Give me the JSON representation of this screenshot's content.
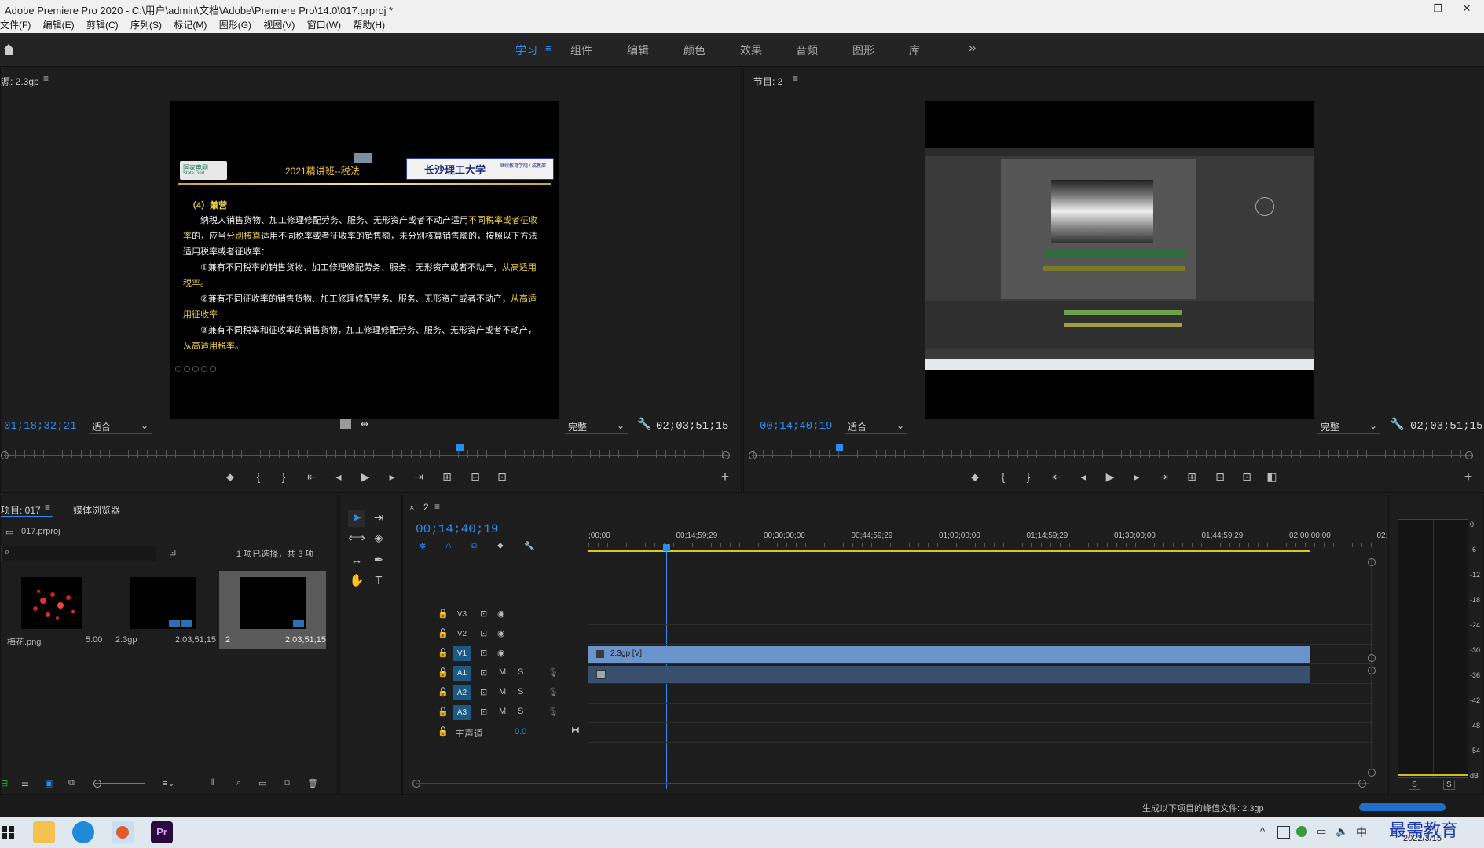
{
  "window": {
    "title": "Adobe Premiere Pro 2020 - C:\\用户\\admin\\文档\\Adobe\\Premiere Pro\\14.0\\017.prproj *",
    "minimize": "—",
    "maximize": "❐",
    "close": "✕"
  },
  "menu": [
    "文件(F)",
    "编辑(E)",
    "剪辑(C)",
    "序列(S)",
    "标记(M)",
    "图形(G)",
    "视图(V)",
    "窗口(W)",
    "帮助(H)"
  ],
  "workspaces": {
    "tabs": [
      "学习",
      "组件",
      "编辑",
      "颜色",
      "效果",
      "音频",
      "图形",
      "库"
    ],
    "active": "学习",
    "more": "»"
  },
  "source_monitor": {
    "title": "源: 2.3gp",
    "timecode": "01;18;32;21",
    "zoom": "适合",
    "quality": "完整",
    "duration": "02;03;51;15",
    "playhead_fraction": 0.63,
    "slide": {
      "logo_left": "国家电网",
      "logo_left_sub": "State Grid",
      "header": "2021精讲班--税法",
      "logo_right": "长沙理工大学",
      "logo_right_sub": "继续教育学院 / 成教部",
      "section": "（4）兼营",
      "p1a": "纳税人销售货物、加工修理修配劳务、服务、无形资产或者不动产适用",
      "p1b": "不同税率或者征收率",
      "p1c": "的，应当",
      "p1d": "分别核算",
      "p1e": "适用不同税率或者征收率的销售额，未分别核算销售额的，按照以下方法适用税率或者征收率：",
      "i1": "①兼有不同税率的销售货物、加工修理修配劳务、服务、无形资产或者不动产，",
      "i1h": "从高适用税率。",
      "i2": "②兼有不同征收率的销售货物、加工修理修配劳务、服务、无形资产或者不动产，",
      "i2h": "从高适用征收率",
      "i3": "③兼有不同税率和征收率的销售货物，加工修理修配劳务、服务、无形资产或者不动产，",
      "i3h": "从高适用税率。"
    }
  },
  "program_monitor": {
    "title": "节目: 2",
    "timecode": "00;14;40;19",
    "zoom": "适合",
    "quality": "完整",
    "duration": "02;03;51;15",
    "playhead_fraction": 0.12
  },
  "project": {
    "tab_project": "项目: 017",
    "tab_media": "媒体浏览器",
    "file": "017.prproj",
    "selection_info": "1 项已选择，共 3 项",
    "items": [
      {
        "name": "梅花.png",
        "duration": "5:00"
      },
      {
        "name": "2.3gp",
        "duration": "2;03;51;15"
      },
      {
        "name": "2",
        "duration": "2;03;51;15"
      }
    ]
  },
  "timeline": {
    "tab": "2",
    "close": "×",
    "timecode": "00;14;40;19",
    "ticks": [
      ";00;00",
      "00;14;59;29",
      "00;30;00;00",
      "00;44;59;29",
      "01;00;00;00",
      "01;14;59;29",
      "01;30;00;00",
      "01;44;59;29",
      "02;00;00;00",
      "02;"
    ],
    "video_tracks": [
      "V3",
      "V2",
      "V1"
    ],
    "audio_tracks": [
      "A1",
      "A2",
      "A3"
    ],
    "master_label": "主声道",
    "master_value": "0.0",
    "clip_label": "2.3gp [V]",
    "mute": "M",
    "solo": "S"
  },
  "audio_meter": {
    "scale": [
      "0",
      "-6",
      "-12",
      "-18",
      "-24",
      "-30",
      "-36",
      "-42",
      "-48",
      "-54",
      "dB"
    ],
    "solo_left": "S",
    "solo_right": "S"
  },
  "status": {
    "text": "生成以下项目的峰值文件: 2.3gp"
  },
  "taskbar": {
    "ime": "中",
    "date": "2022/3/15",
    "watermark": "最需教育"
  }
}
